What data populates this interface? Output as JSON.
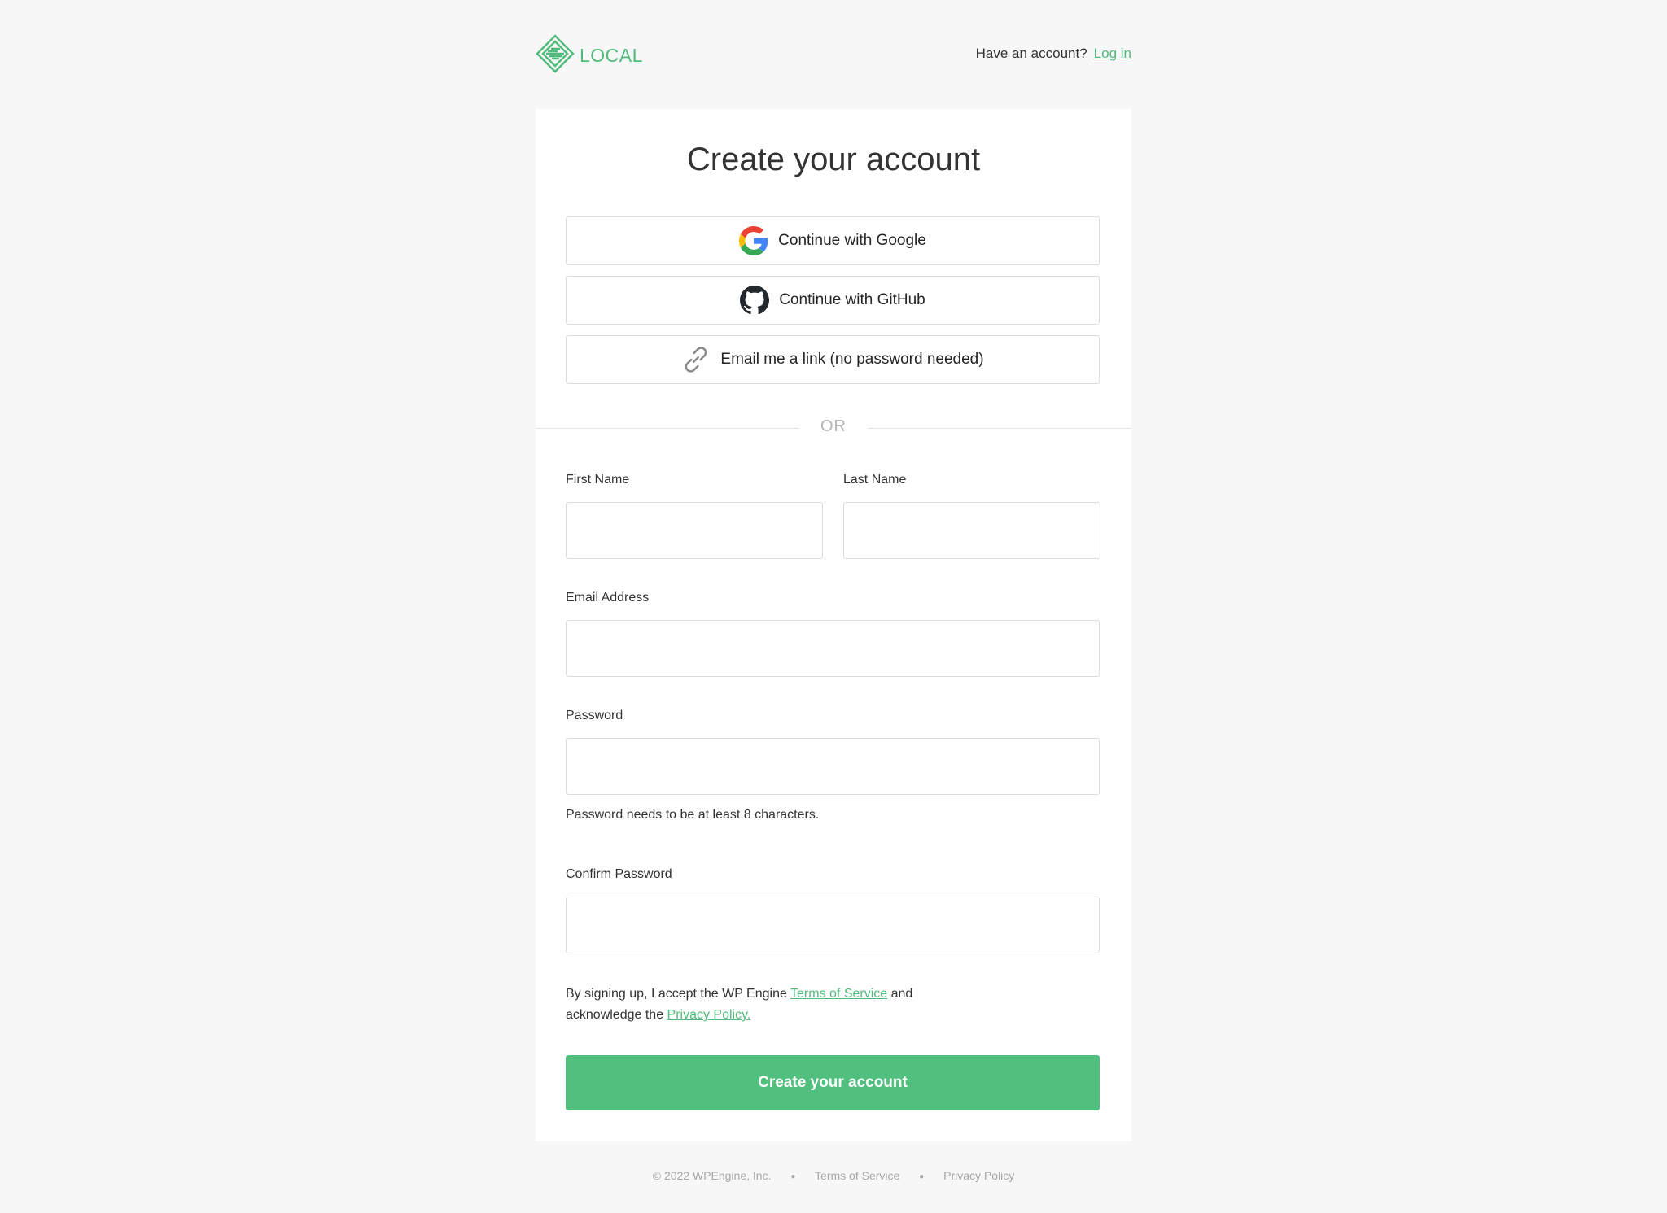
{
  "header": {
    "logo_text": "LOCAL",
    "account_prompt": "Have an account?",
    "login_link": "Log in"
  },
  "card": {
    "title": "Create your account",
    "sso": {
      "google_label": "Continue with Google",
      "github_label": "Continue with GitHub",
      "email_link_label": "Email me a link (no password needed)"
    },
    "divider_text": "OR",
    "form": {
      "first_name_label": "First Name",
      "first_name_value": "",
      "last_name_label": "Last Name",
      "last_name_value": "",
      "email_label": "Email Address",
      "email_value": "",
      "password_label": "Password",
      "password_value": "",
      "password_hint": "Password needs to be at least 8 characters.",
      "confirm_password_label": "Confirm Password",
      "confirm_password_value": ""
    },
    "legal": {
      "prefix": "By signing up, I accept the WP Engine ",
      "terms_link": "Terms of Service",
      "middle": " and acknowledge the ",
      "privacy_link": "Privacy Policy."
    },
    "submit_label": "Create your account"
  },
  "footer": {
    "copyright": "© 2022 WPEngine, Inc.",
    "terms": "Terms of Service",
    "privacy": "Privacy Policy"
  },
  "colors": {
    "accent": "#51bf7d",
    "background": "#f7f7f7",
    "card": "#ffffff"
  },
  "icons": {
    "logo": "local-logo-icon",
    "google": "google-icon",
    "github": "github-icon",
    "link": "link-icon"
  }
}
